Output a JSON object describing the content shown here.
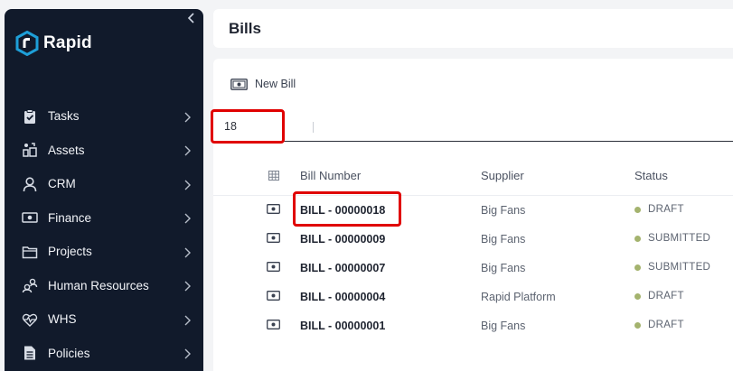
{
  "sidebar": {
    "collapse_icon": "chevron-left-icon",
    "logo_text": "Rapid",
    "items": [
      {
        "label": "Tasks",
        "icon": "clipboard-check-icon"
      },
      {
        "label": "Assets",
        "icon": "assets-icon"
      },
      {
        "label": "CRM",
        "icon": "user-icon"
      },
      {
        "label": "Finance",
        "icon": "money-icon"
      },
      {
        "label": "Projects",
        "icon": "folder-icon"
      },
      {
        "label": "Human Resources",
        "icon": "people-icon"
      },
      {
        "label": "WHS",
        "icon": "heartbeat-icon"
      },
      {
        "label": "Policies",
        "icon": "document-icon"
      }
    ]
  },
  "header": {
    "title": "Bills"
  },
  "toolbar": {
    "new_bill_label": "New Bill"
  },
  "search": {
    "value": "18"
  },
  "table": {
    "columns": [
      "Bill Number",
      "Supplier",
      "Status"
    ],
    "rows": [
      {
        "number": "BILL - 00000018",
        "supplier": "Big Fans",
        "status": "DRAFT"
      },
      {
        "number": "BILL - 00000009",
        "supplier": "Big Fans",
        "status": "SUBMITTED"
      },
      {
        "number": "BILL - 00000007",
        "supplier": "Big Fans",
        "status": "SUBMITTED"
      },
      {
        "number": "BILL - 00000004",
        "supplier": "Rapid Platform",
        "status": "DRAFT"
      },
      {
        "number": "BILL - 00000001",
        "supplier": "Big Fans",
        "status": "DRAFT"
      }
    ]
  },
  "colors": {
    "sidebar_bg": "#111a2b",
    "highlight": "#e00000",
    "status_dot": "#a4b36e",
    "logo_accent": "#1e9fd8"
  }
}
